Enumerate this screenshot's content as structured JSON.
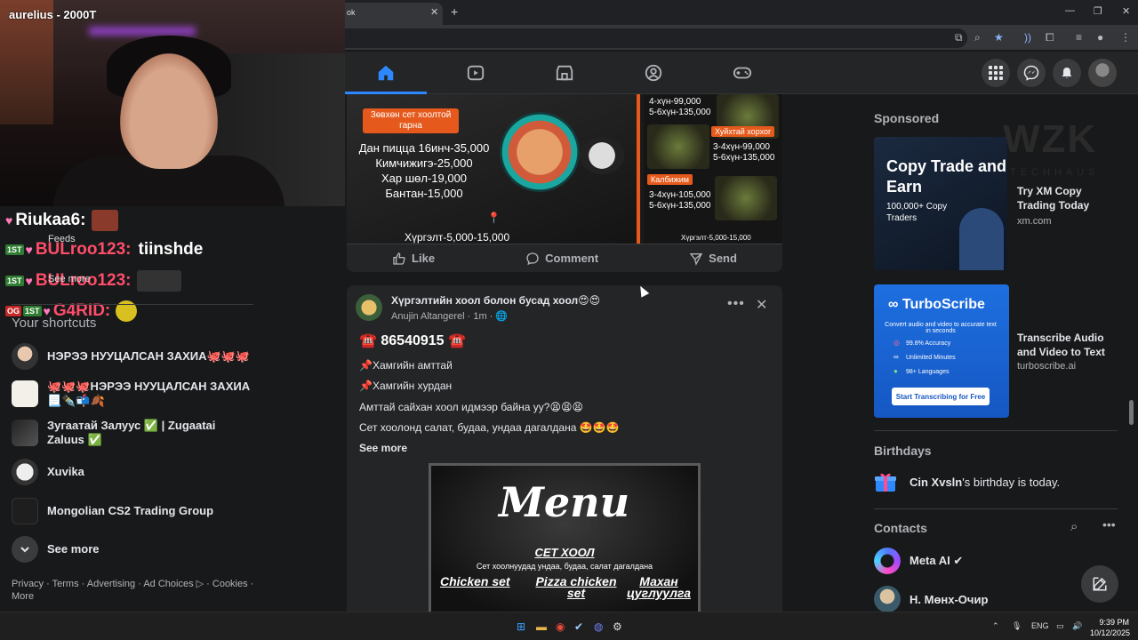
{
  "webcam": {
    "title": "aurelius - 2000T"
  },
  "chat": [
    {
      "badges": [
        "heart"
      ],
      "user": "Riukaa6:",
      "message": "",
      "user_color": "#ffffff"
    },
    {
      "badges": [
        "1ST",
        "heart"
      ],
      "user": "BULroo123:",
      "message": "tiinshde",
      "user_color": "#ff4d6a"
    },
    {
      "badges": [
        "1ST",
        "heart"
      ],
      "user": "BULroo123:",
      "message": "",
      "user_color": "#ff4d6a"
    },
    {
      "badges": [
        "OG",
        "1ST",
        "heart"
      ],
      "user": "G4RID:",
      "message": "",
      "user_color": "#ff4d6a"
    }
  ],
  "sidebar": {
    "feeds_label": "Feeds",
    "see_more_small": "See more",
    "shortcuts_heading": "Your shortcuts",
    "items": [
      {
        "label": "НЭРЭЭ НУУЦАЛСАН ЗАХИА🐙🐙🐙"
      },
      {
        "label": "🐙🐙🐙НЭРЭЭ НУУЦАЛСАН ЗАХИА📃✒️📬🍂"
      },
      {
        "label": "Зугаатай Залуус ✅ | Zugaatai Zaluus ✅"
      },
      {
        "label": "Xuvika"
      },
      {
        "label": "Mongolian CS2 Trading Group"
      }
    ],
    "see_more": "See more",
    "footer": "Privacy · Terms · Advertising · Ad Choices ▷ · Cookies · More"
  },
  "browser": {
    "tab_title": "ok",
    "icons": [
      "cast-icon",
      "zoom-icon",
      "bookmark-star-icon",
      "extension-icon",
      "menu-icon"
    ]
  },
  "nav": {
    "tabs": [
      "home-icon",
      "video-icon",
      "marketplace-icon",
      "groups-icon",
      "gaming-icon"
    ],
    "active_color": "#2d88ff"
  },
  "post1": {
    "set_label": "Зөвхөн сет хоолтой гарна",
    "menu_lines": [
      "Дан пицца 16инч-35,000",
      "Кимчижигэ-25,000",
      "Хар шөл-19,000",
      "Бантан-15,000"
    ],
    "delivery": "Хүргэлт-5,000-15,000",
    "right_prices_top": [
      "4-хүн-99,000",
      "5-6хүн-135,000"
    ],
    "tag1": "Хуйхтай хорхог",
    "right_prices_mid": [
      "3-4хүн-99,000",
      "5-6хүн-135,000"
    ],
    "tag2": "Калбижим",
    "right_prices_bot": [
      "3-4хүн-105,000",
      "5-6хүн-135,000"
    ],
    "delivery_small": "Хүргэлт-5,000-15,000",
    "actions": {
      "like": "Like",
      "comment": "Comment",
      "send": "Send"
    }
  },
  "post2": {
    "title": "Хүргэлтийн хоол болон бусад хоол😍😍",
    "author": "Anujin Altangerel",
    "time": "· 1m · 🌐",
    "phone": "☎️ 86540915 ☎️",
    "lines": [
      "📌Хамгийн амттай",
      "📌Хамгийн хурдан",
      "Амттай сайхан хоол идмээр байна уу?😫😫😫",
      "Сет хоолонд салат, будаа, ундаа дагалдана 🤩🤩🤩"
    ],
    "see_more": "See more",
    "menu_image": {
      "title": "Menu",
      "subtitle": "СЕТ ХООЛ",
      "small": "Сет хоолнуудад ундаа, будаа, салат дагалдана",
      "col1": "Chicken set",
      "col2": "Pizza chicken set",
      "col3": "Махан цуглуулга"
    }
  },
  "right": {
    "sponsored": "Sponsored",
    "ad1": {
      "headline": "Copy Trade and Earn",
      "sub": "100,000+ Copy Traders",
      "title": "Try XM Copy Trading Today",
      "url": "xm.com"
    },
    "watermark": {
      "big": "WZK",
      "small": "TECHHAUS"
    },
    "ad2": {
      "logo": "∞ TurboScribe",
      "tagline": "Convert audio and video to accurate text in seconds",
      "features": [
        "99.8% Accuracy",
        "Unlimited Minutes",
        "98+ Languages"
      ],
      "button": "Start Transcribing for Free",
      "title": "Transcribe Audio and Video to Text",
      "url": "turboscribe.ai"
    },
    "birthdays_heading": "Birthdays",
    "birthday_name": "Cin Xvsln",
    "birthday_text": "'s birthday is today.",
    "contacts_heading": "Contacts",
    "contacts": [
      {
        "name": "Meta AI ✔"
      },
      {
        "name": "Н. Мөнх-Очир"
      }
    ]
  },
  "taskbar": {
    "lang": "ENG",
    "time": "9:39 PM",
    "date": "10/12/2025"
  }
}
